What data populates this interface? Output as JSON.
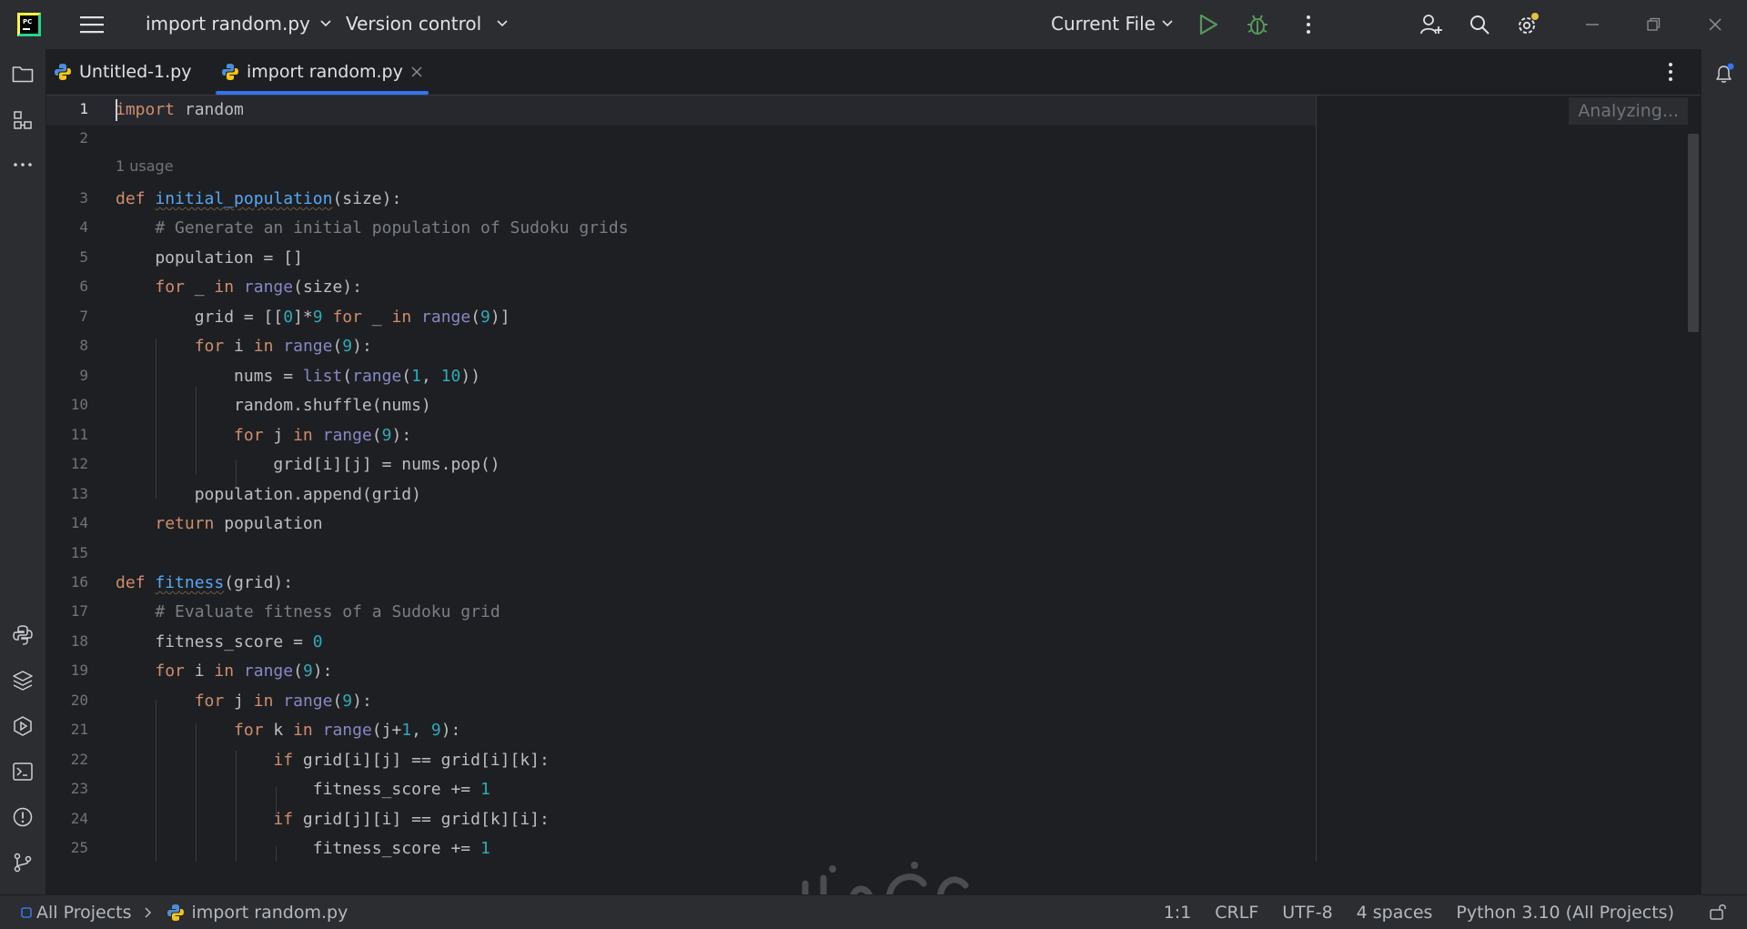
{
  "titlebar": {
    "project_widget": "import random.py",
    "vcs_widget": "Version control",
    "run_config": "Current File"
  },
  "tabs": [
    {
      "label": "Untitled-1.py",
      "active": false
    },
    {
      "label": "import random.py",
      "active": true
    }
  ],
  "editor": {
    "analyzing_label": "Analyzing...",
    "usage_hint": "1 usage",
    "line_numbers": [
      "1",
      "2",
      "3",
      "4",
      "5",
      "6",
      "7",
      "8",
      "9",
      "10",
      "11",
      "12",
      "13",
      "14",
      "15",
      "16",
      "17",
      "18",
      "19",
      "20",
      "21",
      "22",
      "23",
      "24",
      "25"
    ],
    "lines": [
      "import random",
      "",
      "def initial_population(size):",
      "    # Generate an initial population of Sudoku grids",
      "    population = []",
      "    for _ in range(size):",
      "        grid = [[0]*9 for _ in range(9)]",
      "        for i in range(9):",
      "            nums = list(range(1, 10))",
      "            random.shuffle(nums)",
      "            for j in range(9):",
      "                grid[i][j] = nums.pop()",
      "        population.append(grid)",
      "    return population",
      "",
      "def fitness(grid):",
      "    # Evaluate fitness of a Sudoku grid",
      "    fitness_score = 0",
      "    for i in range(9):",
      "        for j in range(9):",
      "            for k in range(j+1, 9):",
      "                if grid[i][j] == grid[i][k]:",
      "                    fitness_score += 1",
      "                if grid[j][i] == grid[k][i]:",
      "                    fitness_score += 1"
    ]
  },
  "statusbar": {
    "breadcrumb_root": "All Projects",
    "breadcrumb_file": "import random.py",
    "position": "1:1",
    "line_separator": "CRLF",
    "encoding": "UTF-8",
    "indent": "4 spaces",
    "interpreter": "Python 3.10 (All Projects)"
  },
  "colors": {
    "accent": "#3574f0",
    "keyword": "#cf8e6d",
    "function": "#56a8f5",
    "builtin": "#8888c6",
    "number": "#2aacb8",
    "comment": "#7a7e85",
    "run": "#57965c",
    "notification_dot": "#e5c03b"
  },
  "icons": [
    "pycharm-logo",
    "main-menu",
    "chevron-down",
    "run",
    "debug",
    "more-vertical",
    "add-user",
    "search",
    "settings",
    "minimize",
    "restore",
    "close",
    "project",
    "structure",
    "more-horizontal",
    "python-console",
    "python-packages",
    "services",
    "terminal",
    "problems",
    "git",
    "notifications",
    "python-file",
    "lock"
  ]
}
